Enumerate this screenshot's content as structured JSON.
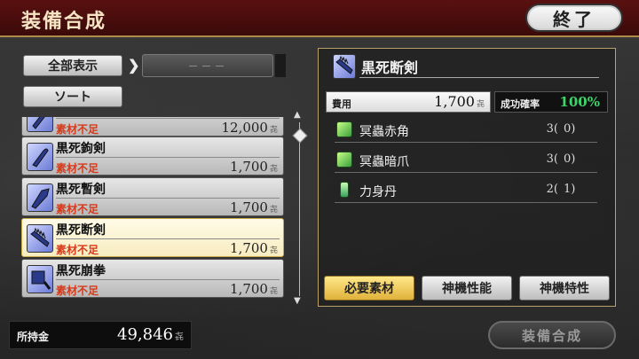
{
  "header": {
    "title": "装備合成",
    "close_label": "終了"
  },
  "left_panel": {
    "show_all_label": "全部表示",
    "sort_label": "ソート",
    "filter_value": "－－－"
  },
  "items": [
    {
      "name": "",
      "status": "素材不足",
      "cost": "12,000",
      "unit": "㐂",
      "selected": false,
      "icon": "blade-icon"
    },
    {
      "name": "黒死鉤剣",
      "status": "素材不足",
      "cost": "1,700",
      "unit": "㐂",
      "selected": false,
      "icon": "hook-sword-icon"
    },
    {
      "name": "黒死暫剣",
      "status": "素材不足",
      "cost": "1,700",
      "unit": "㐂",
      "selected": false,
      "icon": "broad-sword-icon"
    },
    {
      "name": "黒死断剣",
      "status": "素材不足",
      "cost": "1,700",
      "unit": "㐂",
      "selected": true,
      "icon": "serrated-sword-icon"
    },
    {
      "name": "黒死崩拳",
      "status": "素材不足",
      "cost": "1,700",
      "unit": "㐂",
      "selected": false,
      "icon": "fist-weapon-icon"
    }
  ],
  "money": {
    "label": "所持金",
    "value": "49,846",
    "unit": "㐂"
  },
  "synth_button_label": "装備合成",
  "detail": {
    "title": "黒死断剣",
    "cost_label": "費用",
    "cost_value": "1,700",
    "cost_unit": "㐂",
    "rate_label": "成功確率",
    "rate_value": "100%",
    "materials": [
      {
        "name": "冥蟲赤角",
        "required": "3(",
        "held": "0)",
        "icon": "green-crystal-icon"
      },
      {
        "name": "冥蟲暗爪",
        "required": "3(",
        "held": "0)",
        "icon": "green-crystal-icon"
      },
      {
        "name": "力身丹",
        "required": "2(",
        "held": "1)",
        "icon": "vial-icon"
      }
    ],
    "tabs": [
      {
        "label": "必要素材",
        "active": true
      },
      {
        "label": "神機性能",
        "active": false
      },
      {
        "label": "神機特性",
        "active": false
      }
    ]
  },
  "colors": {
    "header_bg": "#5a1010",
    "gold_border": "#b8a26a",
    "status_red": "#d63a1a",
    "rate_green": "#3fd36a",
    "tab_active": "#e0b23a"
  }
}
